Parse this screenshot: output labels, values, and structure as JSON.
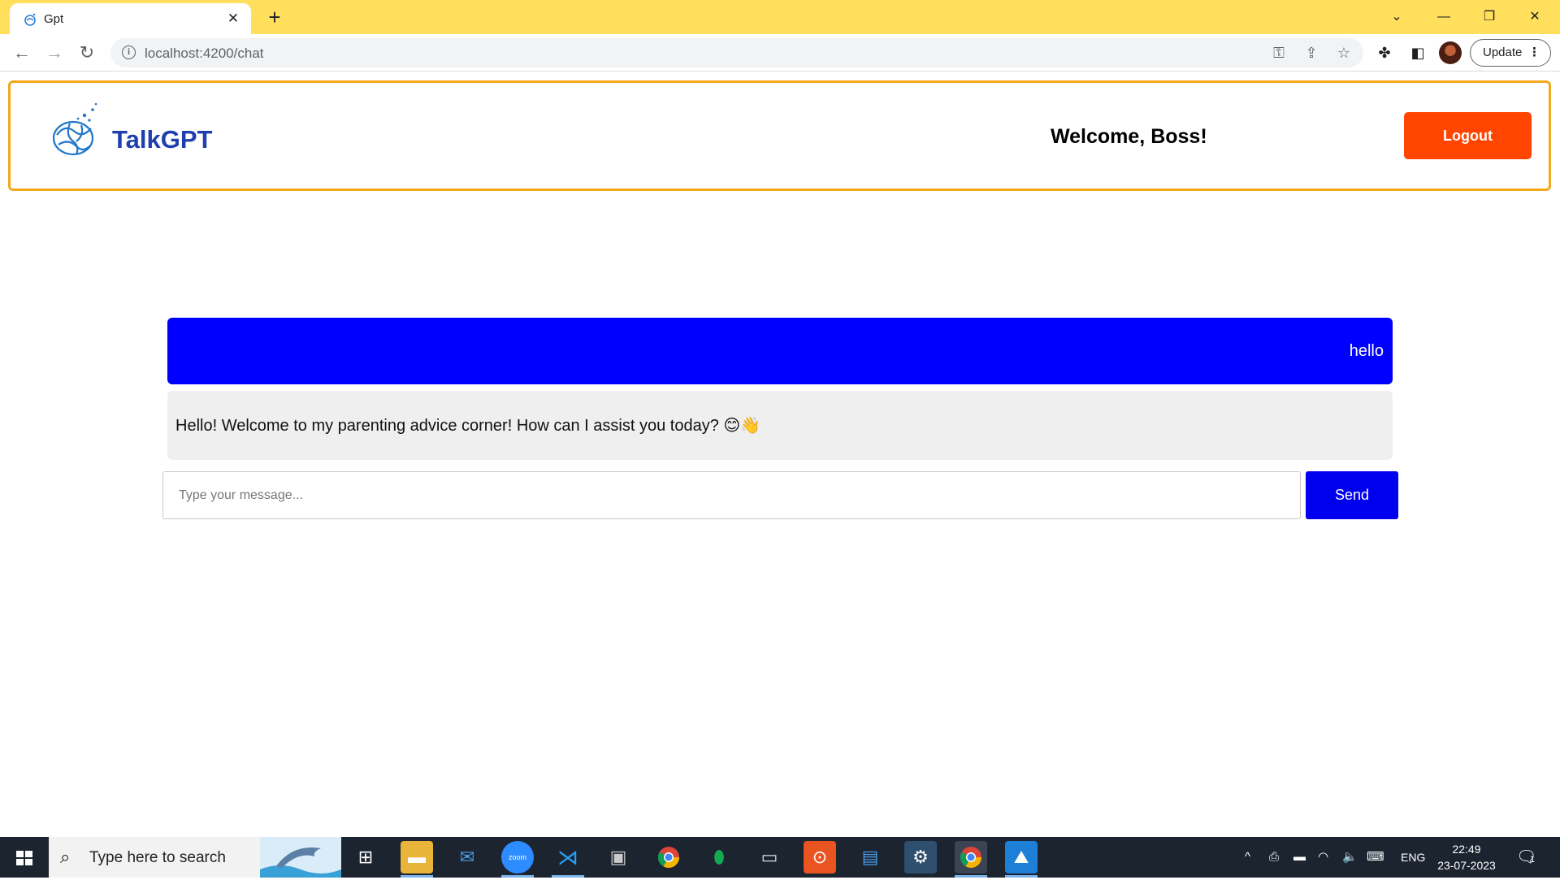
{
  "browser": {
    "tab_title": "Gpt",
    "url": "localhost:4200/chat",
    "update_label": "Update"
  },
  "header": {
    "brand": "TalkGPT",
    "welcome": "Welcome, Boss!",
    "logout_label": "Logout"
  },
  "chat": {
    "messages": [
      {
        "role": "user",
        "text": "hello"
      },
      {
        "role": "assistant",
        "text": "Hello! Welcome to my parenting advice corner! How can I assist you today? 😊👋"
      }
    ],
    "input_placeholder": "Type your message...",
    "send_label": "Send"
  },
  "taskbar": {
    "search_placeholder": "Type here to search",
    "language": "ENG",
    "time": "22:49",
    "date": "23-07-2023",
    "notification_count": "1"
  },
  "colors": {
    "tabstrip": "#ffdf5b",
    "header_border": "#f3a81c",
    "logout": "#ff4500",
    "user_bubble": "#0000ff",
    "send": "#0000ee"
  }
}
